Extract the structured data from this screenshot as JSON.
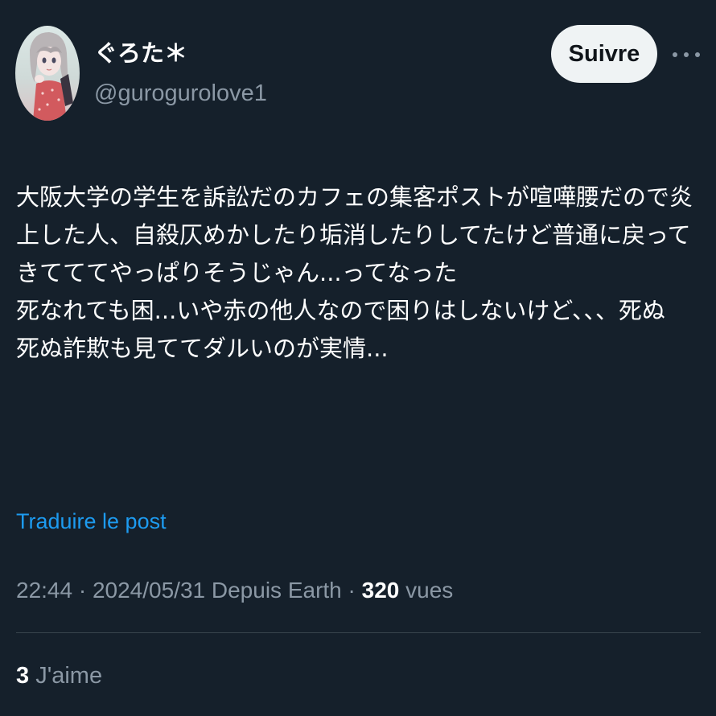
{
  "user": {
    "display_name": "ぐろた＊",
    "handle": "@gurogurolove1",
    "avatar_icon": "profile-avatar-illustration"
  },
  "actions": {
    "follow_label": "Suivre",
    "more_icon": "more-options-icon"
  },
  "tweet": {
    "lines": [
      "大阪大学の学生を訴訟だのカフェの集客ポストが喧嘩腰だので炎",
      "上した人、自殺仄めかしたり垢消したりしてたけど普通に戻って",
      "きてててやっぱりそうじゃん...ってなった",
      "死なれても困...いや赤の他人なので困りはしないけど、、、死ぬ",
      "死ぬ詐欺も見ててダルいのが実情..."
    ]
  },
  "translate_label": "Traduire le post",
  "meta": {
    "time": "22:44",
    "date": "2024/05/31",
    "source": "Depuis Earth",
    "separator": "·",
    "views_count": "320",
    "views_label": "vues"
  },
  "likes": {
    "count": "3",
    "label": "J'aime"
  },
  "colors": {
    "background": "#15202b",
    "text_primary": "#ffffff",
    "text_secondary": "#8b98a5",
    "link": "#1d9bf0",
    "follow_button_bg": "#eff3f4"
  }
}
